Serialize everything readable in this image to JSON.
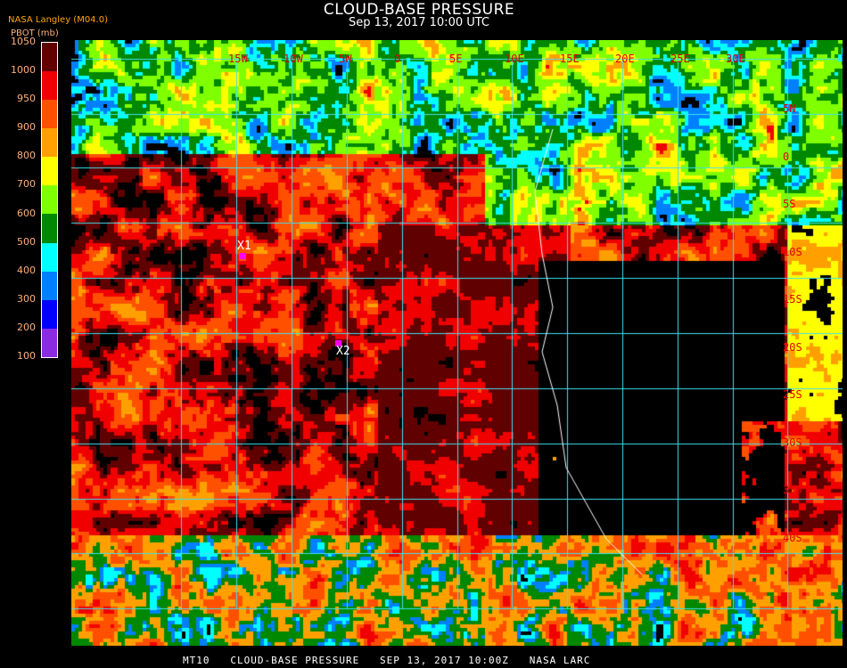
{
  "header": {
    "title": "CLOUD-BASE PRESSURE",
    "subtitle": "Sep 13, 2017 10:00 UTC",
    "source": "NASA Langley (M04.0)"
  },
  "legend": {
    "units": "PBOT (mb)",
    "ticks": [
      "1050",
      "1000",
      "950",
      "900",
      "800",
      "700",
      "600",
      "500",
      "400",
      "300",
      "200",
      "100"
    ],
    "colors": [
      "#600000",
      "#f00000",
      "#ff5000",
      "#ffa000",
      "#ffff00",
      "#80ff00",
      "#008800",
      "#00ffff",
      "#0080ff",
      "#0000ff",
      "#8a2be2"
    ]
  },
  "map": {
    "lon_labels": [
      "15W",
      "10W",
      "5W",
      "0",
      "5E",
      "10E",
      "15E",
      "20E",
      "25E",
      "30E"
    ],
    "lat_labels": [
      "5N",
      "0",
      "5S",
      "10S",
      "15S",
      "20S",
      "25S",
      "30S",
      "35S",
      "40S"
    ],
    "markers": [
      {
        "label": "X1"
      },
      {
        "label": "X2"
      }
    ]
  },
  "footer": "MT10   CLOUD-BASE PRESSURE   SEP 13, 2017 10:00Z   NASA LARC"
}
